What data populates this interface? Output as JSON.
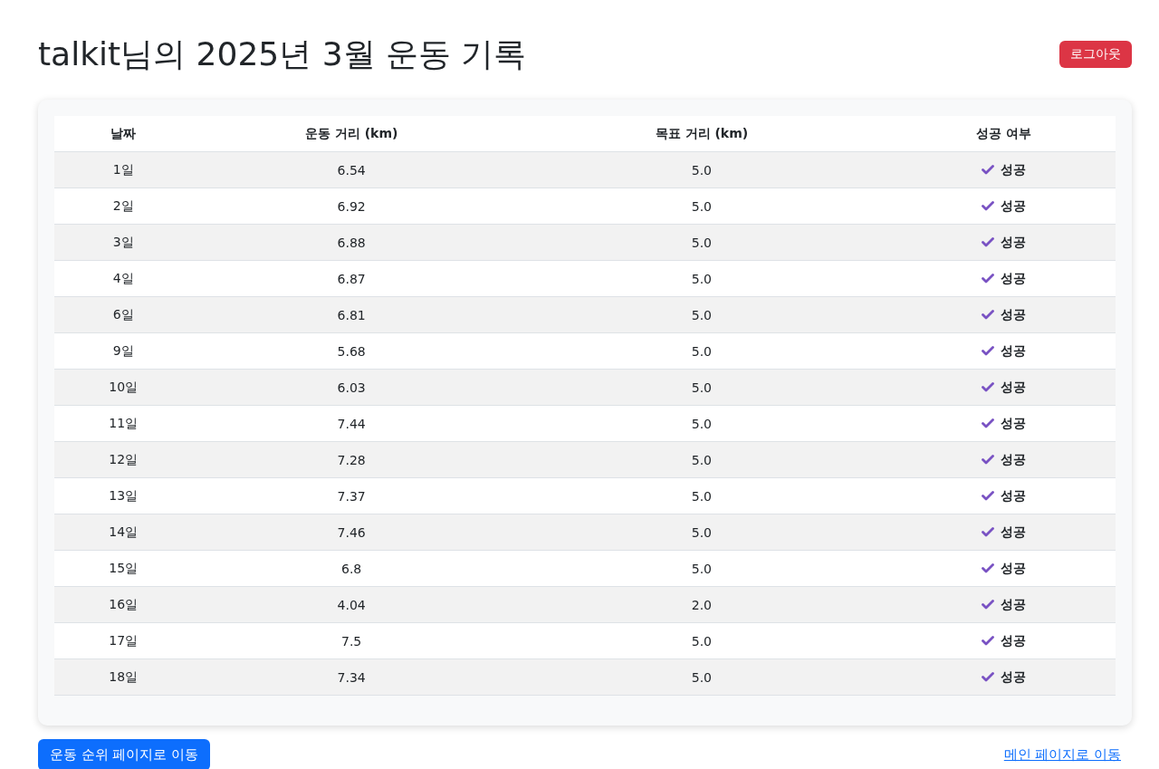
{
  "title": "talkit님의 2025년 3월 운동 기록",
  "logout_button": "로그아웃",
  "table": {
    "columns": [
      "날짜",
      "운동 거리 (km)",
      "목표 거리 (km)",
      "성공 여부"
    ],
    "rows": [
      {
        "date": "1일",
        "distance": "6.54",
        "goal": "5.0",
        "result": "성공",
        "success": true
      },
      {
        "date": "2일",
        "distance": "6.92",
        "goal": "5.0",
        "result": "성공",
        "success": true
      },
      {
        "date": "3일",
        "distance": "6.88",
        "goal": "5.0",
        "result": "성공",
        "success": true
      },
      {
        "date": "4일",
        "distance": "6.87",
        "goal": "5.0",
        "result": "성공",
        "success": true
      },
      {
        "date": "6일",
        "distance": "6.81",
        "goal": "5.0",
        "result": "성공",
        "success": true
      },
      {
        "date": "9일",
        "distance": "5.68",
        "goal": "5.0",
        "result": "성공",
        "success": true
      },
      {
        "date": "10일",
        "distance": "6.03",
        "goal": "5.0",
        "result": "성공",
        "success": true
      },
      {
        "date": "11일",
        "distance": "7.44",
        "goal": "5.0",
        "result": "성공",
        "success": true
      },
      {
        "date": "12일",
        "distance": "7.28",
        "goal": "5.0",
        "result": "성공",
        "success": true
      },
      {
        "date": "13일",
        "distance": "7.37",
        "goal": "5.0",
        "result": "성공",
        "success": true
      },
      {
        "date": "14일",
        "distance": "7.46",
        "goal": "5.0",
        "result": "성공",
        "success": true
      },
      {
        "date": "15일",
        "distance": "6.8",
        "goal": "5.0",
        "result": "성공",
        "success": true
      },
      {
        "date": "16일",
        "distance": "4.04",
        "goal": "2.0",
        "result": "성공",
        "success": true
      },
      {
        "date": "17일",
        "distance": "7.5",
        "goal": "5.0",
        "result": "성공",
        "success": true
      },
      {
        "date": "18일",
        "distance": "7.34",
        "goal": "5.0",
        "result": "성공",
        "success": true
      }
    ]
  },
  "ranking_button": "운동 순위 페이지로 이동",
  "main_link": "메인 페이지로 이동"
}
